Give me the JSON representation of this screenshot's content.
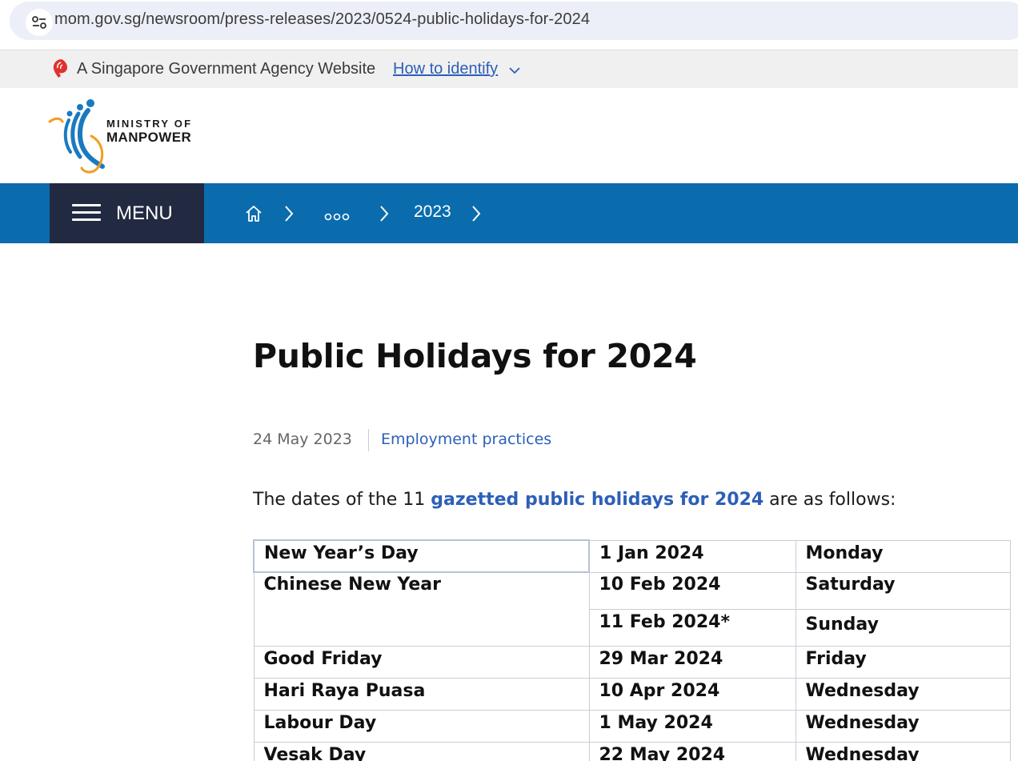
{
  "browser": {
    "url": "mom.gov.sg/newsroom/press-releases/2023/0524-public-holidays-for-2024"
  },
  "masthead": {
    "text": "A Singapore Government Agency Website",
    "link": "How to identify"
  },
  "logo": {
    "line1": "MINISTRY OF",
    "line2": "MANPOWER"
  },
  "nav": {
    "menu_label": "MENU",
    "breadcrumb_ellipsis": "...",
    "breadcrumb_year": "2023"
  },
  "article": {
    "title": "Public Holidays for 2024",
    "date": "24 May 2023",
    "tag": "Employment practices",
    "intro_before": "The dates of the 11 ",
    "intro_link": "gazetted public holidays for 2024",
    "intro_after": " are as follows:"
  },
  "holidays": [
    {
      "name": "New Year’s Day",
      "date": "1 Jan 2024",
      "day": "Monday"
    },
    {
      "name": "Chinese New Year",
      "date": "10 Feb 2024",
      "day": "Saturday"
    },
    {
      "name": "",
      "date": "11 Feb 2024*",
      "day": "Sunday"
    },
    {
      "name": "Good Friday",
      "date": "29 Mar 2024",
      "day": "Friday"
    },
    {
      "name": "Hari Raya Puasa",
      "date": "10 Apr 2024",
      "day": "Wednesday"
    },
    {
      "name": "Labour Day",
      "date": "1 May 2024",
      "day": "Wednesday"
    },
    {
      "name": "Vesak Day",
      "date": "22 May 2024",
      "day": "Wednesday"
    }
  ],
  "colors": {
    "nav_blue": "#0a6cad",
    "menu_dark": "#212a40",
    "link_blue": "#2c5fb8",
    "logo_blue": "#1a7abf",
    "logo_orange": "#f39c1f"
  }
}
